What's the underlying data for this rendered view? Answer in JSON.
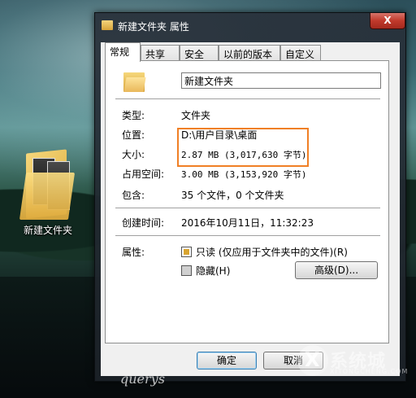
{
  "desktop": {
    "icon_label": "新建文件夹"
  },
  "window": {
    "title": "新建文件夹 属性",
    "close_label": "X",
    "tabs": [
      {
        "label": "常规",
        "active": true
      },
      {
        "label": "共享",
        "active": false
      },
      {
        "label": "安全",
        "active": false
      },
      {
        "label": "以前的版本",
        "active": false
      },
      {
        "label": "自定义",
        "active": false
      }
    ],
    "name_value": "新建文件夹",
    "fields": {
      "type_label": "类型:",
      "type_value": "文件夹",
      "location_label": "位置:",
      "location_value": "D:\\用户目录\\桌面",
      "size_label": "大小:",
      "size_value": "2.87 MB (3,017,630 字节)",
      "size_on_disk_label": "占用空间:",
      "size_on_disk_value": "3.00 MB (3,153,920 字节)",
      "contains_label": "包含:",
      "contains_value": "35 个文件，0 个文件夹",
      "created_label": "创建时间:",
      "created_value": "2016年10月11日，11:32:23",
      "attributes_label": "属性:",
      "readonly_label": "只读 (仅应用于文件夹中的文件)(R)",
      "hidden_label": "隐藏(H)",
      "advanced_label": "高级(D)..."
    },
    "buttons": {
      "ok_label": "确定",
      "cancel_label": "取消"
    }
  },
  "watermark": {
    "signature": "querys",
    "logo_cn": "系统城",
    "logo_en": "XITONGCHENG.COM"
  },
  "colors": {
    "highlight_box": "#f07f25",
    "folder_yellow": "#e9b85a"
  }
}
